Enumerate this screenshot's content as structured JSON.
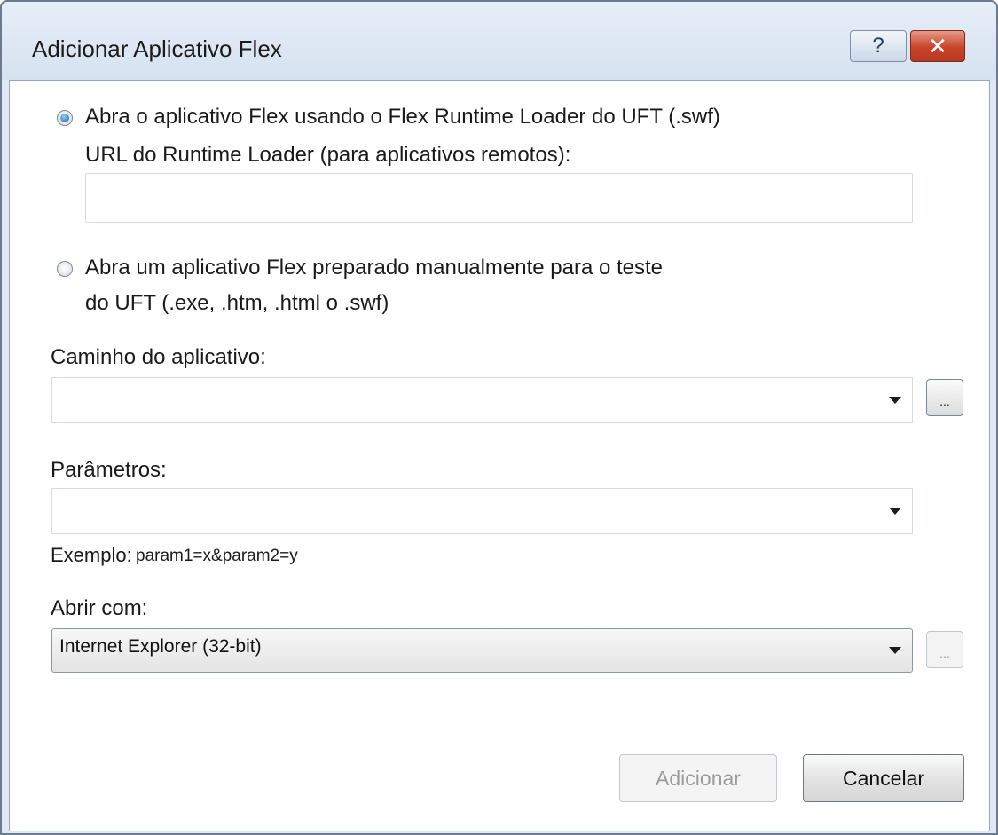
{
  "window": {
    "title": "Adicionar Aplicativo Flex",
    "help_label": "?",
    "close_label": "✕"
  },
  "options": {
    "runtime_loader_label": "Abra o aplicativo Flex usando o Flex Runtime Loader do UFT (.swf)",
    "runtime_loader_checked": true,
    "url_label": "URL do Runtime Loader (para aplicativos remotos):",
    "url_value": "",
    "manual_label_line1": "Abra um aplicativo Flex preparado manualmente para o teste",
    "manual_label_line2": "do UFT (.exe, .htm, .html o .swf)",
    "manual_checked": false
  },
  "app_path": {
    "label": "Caminho do aplicativo:",
    "value": "",
    "browse_label": "..."
  },
  "params": {
    "label": "Parâmetros:",
    "value": "",
    "example_prefix": "Exemplo:",
    "example_value": "param1=x&param2=y"
  },
  "open_with": {
    "label": "Abrir com:",
    "selected": "Internet Explorer (32-bit)",
    "browse_label": "..."
  },
  "buttons": {
    "add_label": "Adicionar",
    "cancel_label": "Cancelar"
  },
  "colors": {
    "titlebar": "#dfe9f5",
    "close_button": "#c8442a",
    "radio_accent": "#1d5ea6"
  }
}
